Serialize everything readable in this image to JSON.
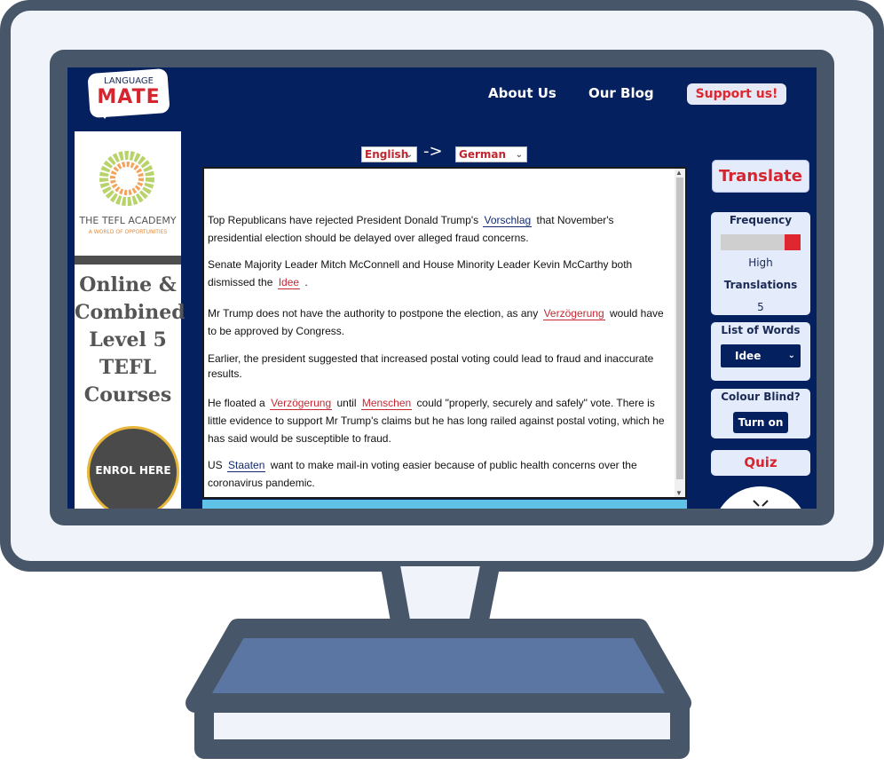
{
  "nav": {
    "logo_top": "LANGUAGE",
    "logo_bottom": "MATE",
    "about": "About Us",
    "blog": "Our Blog",
    "support": "Support us!"
  },
  "ads": {
    "academy_name": "THE TEFL ACADEMY",
    "academy_tagline": "A WORLD OF OPPORTUNITIES",
    "course_lines": [
      "Online &",
      "Combined",
      "Level 5",
      "TEFL",
      "Courses"
    ],
    "enrol": "ENROL HERE"
  },
  "translator": {
    "source_lang": "English",
    "target_lang": "German",
    "arrow": "->",
    "paragraphs": [
      [
        {
          "t": "Top Republicans have rejected President Donald Trump's"
        },
        {
          "w": "Vorschlag",
          "c": "blue"
        },
        {
          "t": "that November's presidential election should be delayed over alleged fraud concerns."
        }
      ],
      [
        {
          "t": "Senate Majority Leader Mitch McConnell and House Minority Leader Kevin McCarthy both dismissed the"
        },
        {
          "w": "Idee",
          "c": "red"
        },
        {
          "t": "."
        }
      ],
      [
        {
          "t": "Mr Trump does not have the authority to postpone the election, as any"
        },
        {
          "w": "Verzögerung",
          "c": "red"
        },
        {
          "t": "would have to be approved by Congress."
        }
      ],
      [
        {
          "t": "Earlier, the president suggested that increased postal voting could lead to fraud and inaccurate results."
        }
      ],
      [
        {
          "t": "He floated a"
        },
        {
          "w": "Verzögerung",
          "c": "red"
        },
        {
          "t": "until"
        },
        {
          "w": "Menschen",
          "c": "red"
        },
        {
          "t": "could \"properly, securely and safely\" vote. There is little evidence to support Mr Trump's claims but he has long railed against postal voting, which he has said would be susceptible to fraud."
        }
      ],
      [
        {
          "t": "US"
        },
        {
          "w": "Staaten",
          "c": "blue"
        },
        {
          "t": "want to make mail-in voting easier because of public health concerns over the coronavirus pandemic."
        }
      ]
    ]
  },
  "sidebar": {
    "translate": "Translate",
    "frequency_label": "Frequency",
    "frequency_level": 0.2,
    "frequency_value": "High",
    "translations_label": "Translations",
    "translations_value": "5",
    "list_label": "List of Words",
    "list_selected": "Idee",
    "colour_blind_label": "Colour Blind?",
    "turn_on": "Turn on",
    "quiz": "Quiz"
  },
  "colors": {
    "screen_bg": "#05205e",
    "accent_red": "#e0262f",
    "monitor_frame": "#475669",
    "monitor_base_fill": "#5b76a2"
  }
}
